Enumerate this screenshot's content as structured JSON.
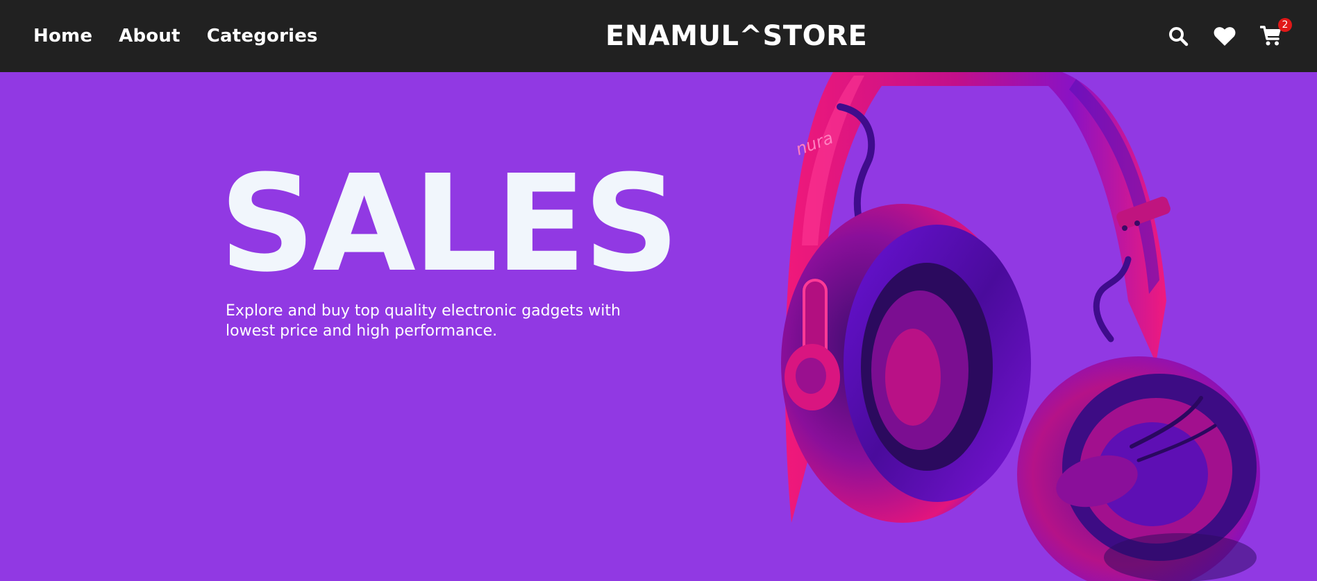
{
  "nav": {
    "links": [
      {
        "label": "Home"
      },
      {
        "label": "About"
      },
      {
        "label": "Categories"
      }
    ],
    "brand": "ENAMUL^STORE",
    "icons": {
      "search": "search-icon",
      "wishlist": "heart-icon",
      "cart": "cart-icon"
    },
    "cart_count": "2"
  },
  "hero": {
    "title": "SALES",
    "description": "Explore and buy top quality electronic gadgets with lowest price and high performance.",
    "product_logo": "nura"
  },
  "colors": {
    "navbar": "#212121",
    "hero_background": "#9139e3",
    "title": "#f1f6fc",
    "badge": "#e11818",
    "headphone_pink": "#f0197a",
    "headphone_violet": "#6a12d6"
  }
}
